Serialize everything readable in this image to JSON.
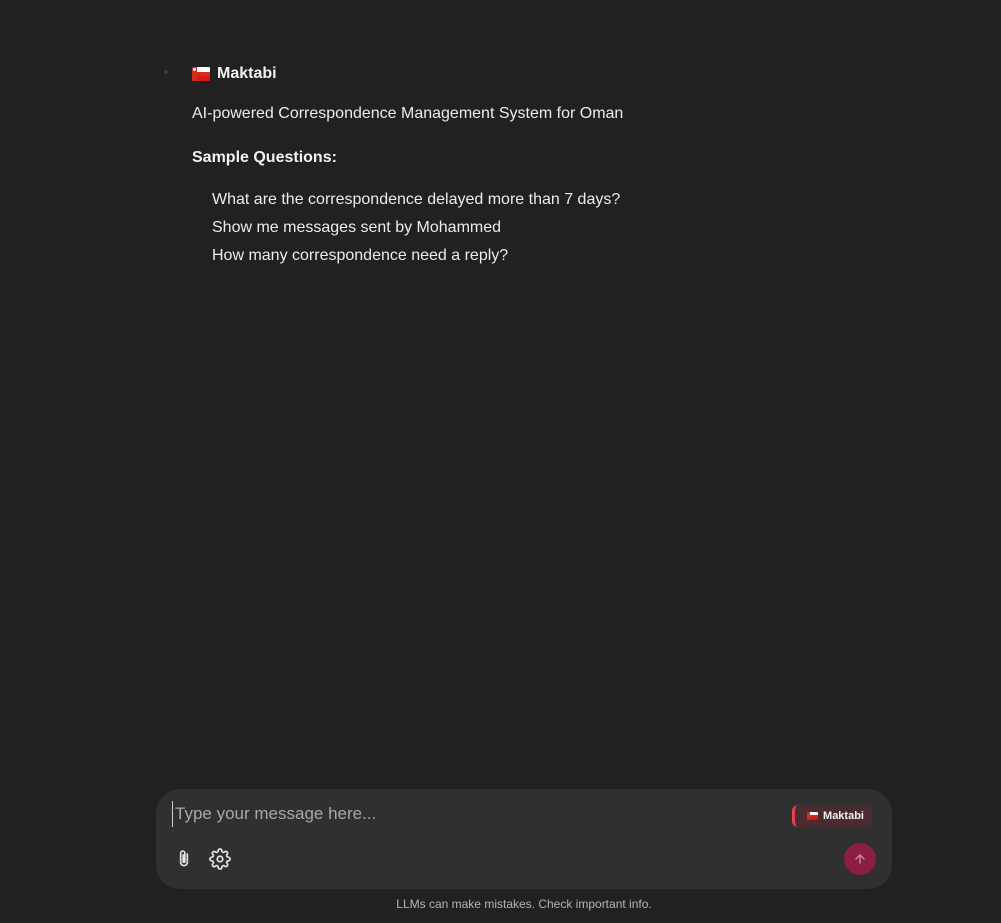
{
  "message": {
    "title": "Maktabi",
    "subtitle": "AI-powered Correspondence Management System for Oman",
    "sample_heading": "Sample Questions:",
    "sample_questions": [
      "What are the correspondence delayed more than 7 days?",
      "Show me messages sent by Mohammed",
      "How many correspondence need a reply?"
    ],
    "title_icon": "oman-flag-icon"
  },
  "composer": {
    "placeholder": "Type your message here...",
    "model_badge_label": "Maktabi",
    "icons": [
      "paperclip-icon",
      "gear-icon",
      "arrow-up-icon"
    ],
    "send_color": "#8b1e45"
  },
  "footer": {
    "note": "LLMs can make mistakes. Check important info."
  },
  "colors": {
    "background": "#212121",
    "composer": "#303030",
    "badge_background": "#4a2b2f",
    "badge_accent": "#e0434f"
  }
}
